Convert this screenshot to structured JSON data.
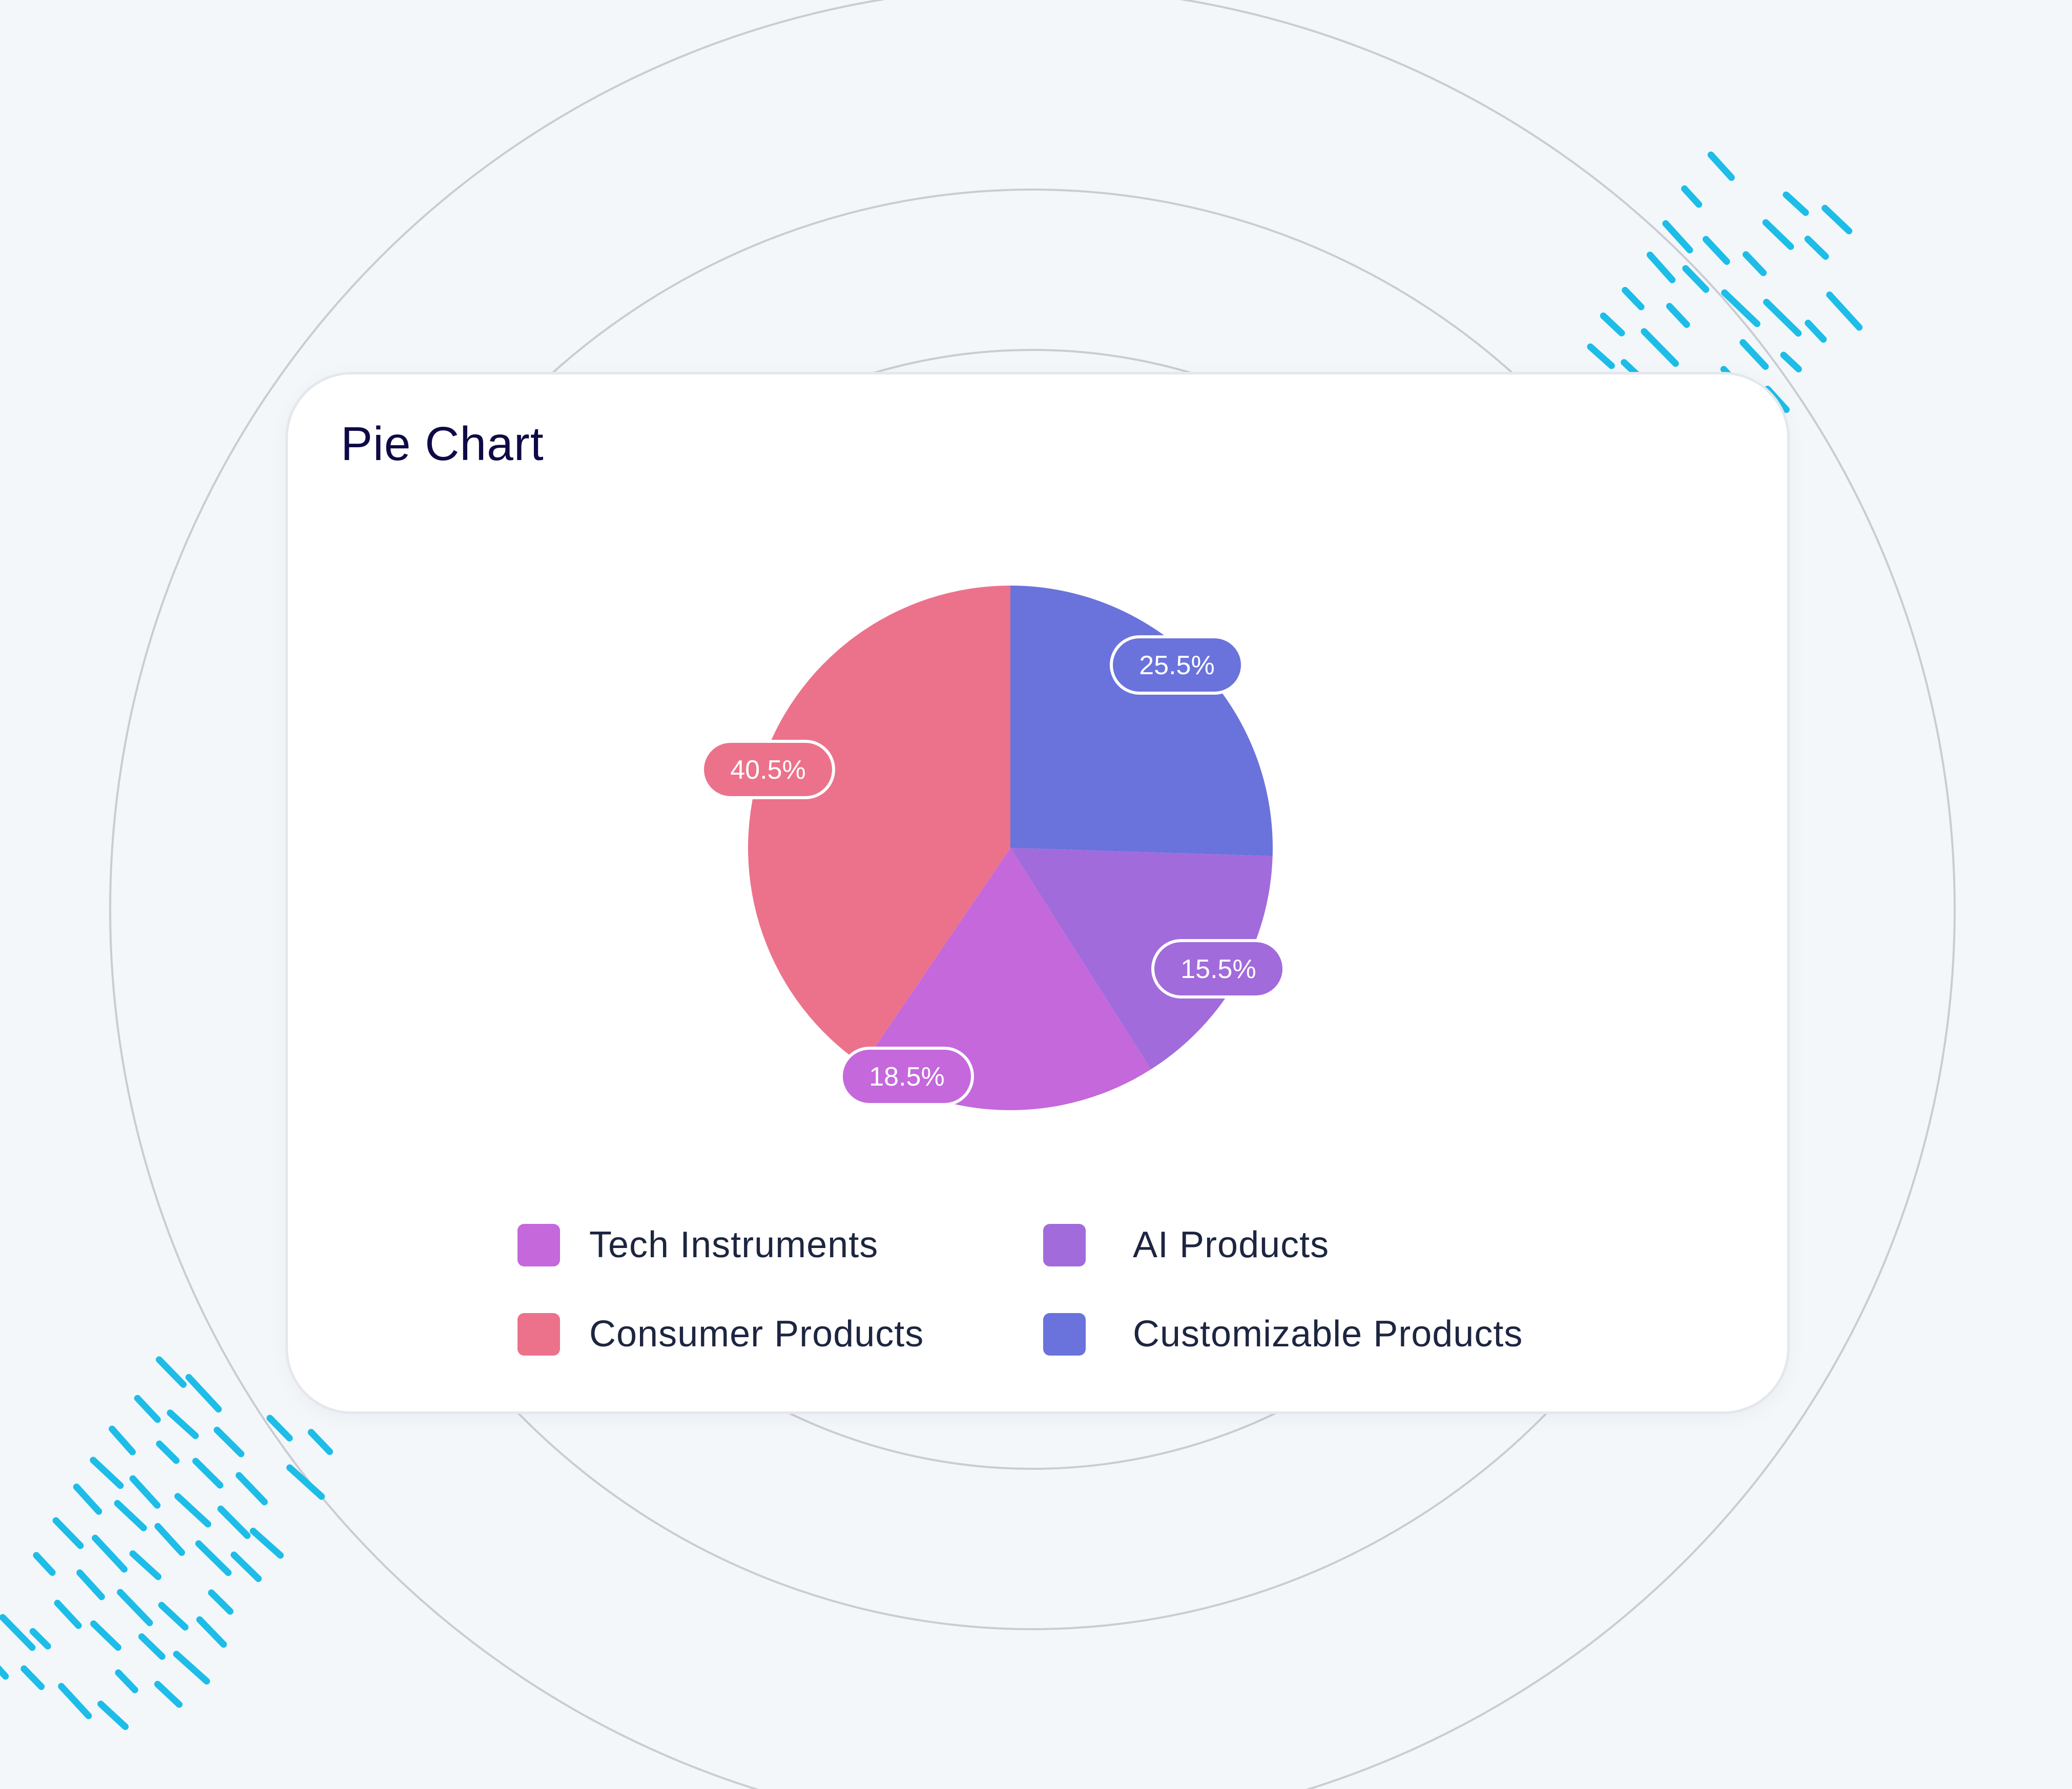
{
  "chart_data": {
    "type": "pie",
    "title": "Pie Chart",
    "slices": [
      {
        "label": "Customizable Products",
        "value": 25.5,
        "display": "25.5%",
        "color": "#6a72dc"
      },
      {
        "label": "AI Products",
        "value": 15.5,
        "display": "15.5%",
        "color": "#a16bdb"
      },
      {
        "label": "Tech Instruments",
        "value": 18.5,
        "display": "18.5%",
        "color": "#c468dc"
      },
      {
        "label": "Consumer Products",
        "value": 40.5,
        "display": "40.5%",
        "color": "#ec728b"
      }
    ],
    "legend": [
      {
        "label": "Tech Instruments",
        "color": "#c468dc"
      },
      {
        "label": "AI Products",
        "color": "#a16bdb"
      },
      {
        "label": "Consumer Products",
        "color": "#ec728b"
      },
      {
        "label": "Customizable Products",
        "color": "#6a72dc"
      }
    ],
    "legend_position": "bottom"
  },
  "decor": {
    "accent": "#1dbde8",
    "ring_color": "#c9ccd2",
    "background": "#f3f7fa"
  }
}
